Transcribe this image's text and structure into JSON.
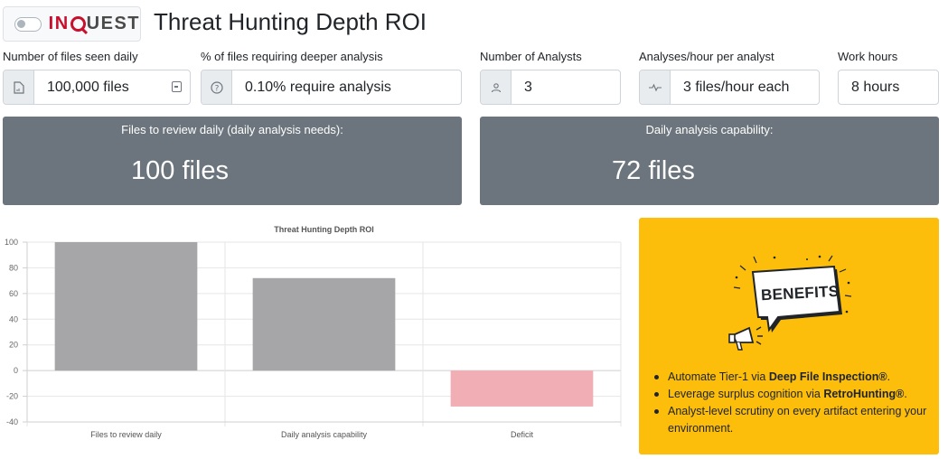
{
  "header": {
    "logo_in": "IN",
    "logo_uest": "UEST",
    "title": "Threat Hunting Depth ROI"
  },
  "inputs": [
    {
      "label": "Number of files seen daily",
      "value": "100,000 files",
      "icon": "document-icon"
    },
    {
      "label": "% of files requiring deeper analysis",
      "value": "0.10% require analysis",
      "icon": "question-circle-icon"
    },
    {
      "label": "Number of Analysts",
      "value": "3",
      "icon": "person-icon"
    },
    {
      "label": "Analyses/hour per analyst",
      "value": "3 files/hour each",
      "icon": "activity-icon"
    },
    {
      "label": "Work hours",
      "value": "8 hours"
    }
  ],
  "cards": {
    "needs": {
      "title": "Files to review daily (daily analysis needs):",
      "value": "100 files"
    },
    "capability": {
      "title": "Daily analysis capability:",
      "value": "72 files"
    }
  },
  "chart_data": {
    "type": "bar",
    "title": "Threat Hunting Depth ROI",
    "categories": [
      "Files to review daily",
      "Daily analysis capability",
      "Deficit"
    ],
    "values": [
      100,
      72,
      -28
    ],
    "colors": [
      "#a6a6a8",
      "#a6a6a8",
      "#f1aeb5"
    ],
    "ylim": [
      -40,
      100
    ],
    "yticks": [
      100,
      80,
      60,
      40,
      20,
      0,
      -20,
      -40
    ],
    "grid": true
  },
  "benefits": {
    "badge": "BENEFITS",
    "items": [
      {
        "pre": "Automate Tier-1 via ",
        "bold": "Deep File Inspection®",
        "post": "."
      },
      {
        "pre": "Leverage surplus cognition via ",
        "bold": "RetroHunting®",
        "post": "."
      },
      {
        "pre": "Analyst-level scrutiny on every artifact entering your environment.",
        "bold": "",
        "post": ""
      }
    ]
  }
}
